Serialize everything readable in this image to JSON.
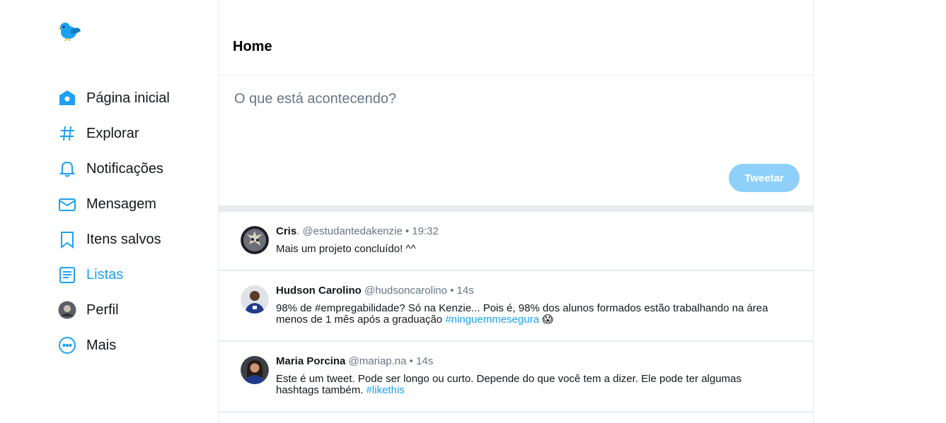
{
  "nav": {
    "items": [
      {
        "label": "Página inicial",
        "icon": "home-icon"
      },
      {
        "label": "Explorar",
        "icon": "hashtag-icon"
      },
      {
        "label": "Notificações",
        "icon": "bell-icon"
      },
      {
        "label": "Mensagem",
        "icon": "mail-icon"
      },
      {
        "label": "Itens salvos",
        "icon": "bookmark-icon"
      },
      {
        "label": "Listas",
        "icon": "list-icon"
      },
      {
        "label": "Perfil",
        "icon": "profile-avatar-icon"
      },
      {
        "label": "Mais",
        "icon": "more-icon"
      }
    ],
    "active": "Listas"
  },
  "header": {
    "title": "Home"
  },
  "composer": {
    "placeholder": "O que está acontecendo?",
    "button_label": "Tweetar"
  },
  "tweets": [
    {
      "name": "Cris",
      "name_suffix": ".",
      "handle": "@estudantedakenzie",
      "time": "• 19:32",
      "text": "Mais um projeto concluído! ^^",
      "hashtag": "",
      "emoji": ""
    },
    {
      "name": "Hudson Carolino",
      "name_suffix": "",
      "handle": "@hudsoncarolino",
      "time": "• 14s",
      "text": "98% de #empregabilidade? Só na Kenzie... Pois é, 98% dos alunos formados estão trabalhando na área menos de 1 mês após a graduação ",
      "hashtag": "#ninguemmesegura",
      "emoji": "😱"
    },
    {
      "name": "Maria Porcina",
      "name_suffix": "",
      "handle": "@mariap.na",
      "time": "• 14s",
      "text": "Este é um tweet. Pode ser longo ou curto. Depende do que você tem a dizer. Ele pode ter algumas hashtags também. ",
      "hashtag": "#likethis",
      "emoji": ""
    }
  ],
  "colors": {
    "accent": "#1da1f2",
    "button_disabled": "#8ed0f9",
    "border": "#e6ecf0",
    "muted": "#657786"
  }
}
